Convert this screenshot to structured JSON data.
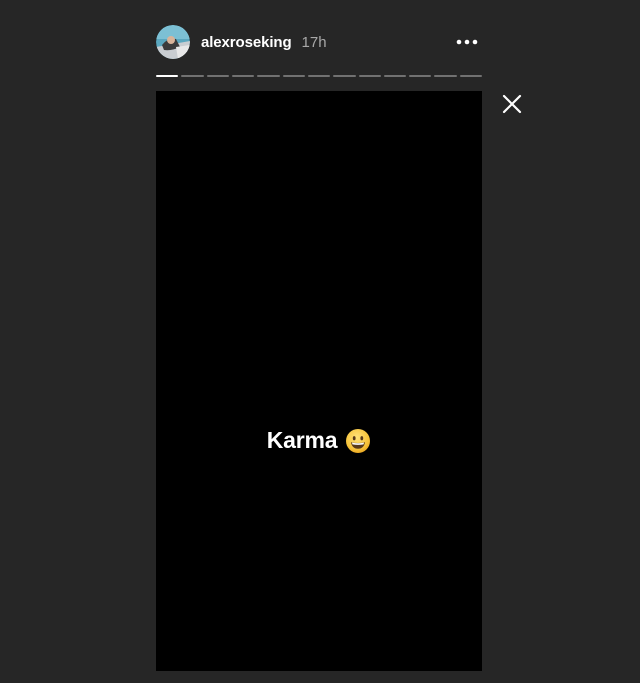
{
  "story": {
    "username": "alexroseking",
    "time_ago": "17h",
    "caption": "Karma",
    "caption_emoji": "grinning-face-emoji",
    "segments_total": 13,
    "current_segment": 1,
    "current_segment_progress": 1.0
  },
  "icons": {
    "more": "more-options-icon",
    "close": "close-icon",
    "avatar": "profile-avatar"
  },
  "colors": {
    "background": "#262626",
    "canvas": "#000000",
    "text": "#ffffff",
    "muted_text": "#a8a8a8",
    "emoji_yellow": "#f7c33a"
  }
}
